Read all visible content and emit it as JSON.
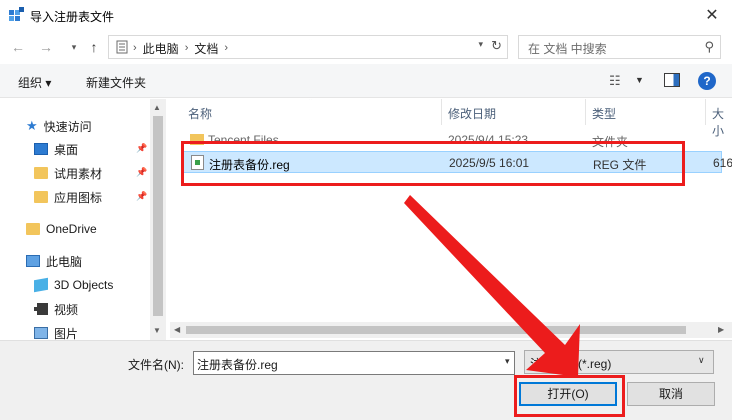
{
  "window": {
    "title": "导入注册表文件",
    "close_icon": "close-icon"
  },
  "navigation": {
    "breadcrumbs": [
      "此电脑",
      "文档"
    ],
    "search_placeholder": "在 文档 中搜索"
  },
  "toolbar": {
    "organize_label": "组织 ▾",
    "new_folder_label": "新建文件夹"
  },
  "sidebar": {
    "items": [
      {
        "label": "快速访问",
        "icon": "star-icon",
        "pinned": false
      },
      {
        "label": "桌面",
        "icon": "desktop-icon",
        "pinned": true
      },
      {
        "label": "试用素材",
        "icon": "folder-icon",
        "pinned": true
      },
      {
        "label": "应用图标",
        "icon": "folder-icon",
        "pinned": true
      },
      {
        "label": "OneDrive",
        "icon": "cloud-folder-icon",
        "pinned": false
      },
      {
        "label": "此电脑",
        "icon": "computer-icon",
        "pinned": false
      },
      {
        "label": "3D Objects",
        "icon": "cube-icon",
        "pinned": false
      },
      {
        "label": "视频",
        "icon": "video-icon",
        "pinned": false
      },
      {
        "label": "图片",
        "icon": "image-icon",
        "pinned": false
      }
    ]
  },
  "file_list": {
    "columns": [
      "名称",
      "修改日期",
      "类型",
      "大小"
    ],
    "rows": [
      {
        "name": "Tencent Files",
        "modified": "2025/9/4 15:23",
        "type": "文件夹",
        "size": "",
        "icon": "folder-icon"
      },
      {
        "name": "注册表备份.reg",
        "modified": "2025/9/5 16:01",
        "type": "REG 文件",
        "size": "616",
        "icon": "reg-file-icon"
      }
    ]
  },
  "footer": {
    "filename_label": "文件名(N):",
    "filename_value": "注册表备份.reg",
    "filetype_value": "注册文件(*.reg)",
    "open_label": "打开(O)",
    "cancel_label": "取消"
  },
  "colors": {
    "selection_bg": "#cce8ff",
    "annotation_red": "#ec1c1c",
    "accent_blue": "#0078d7"
  }
}
